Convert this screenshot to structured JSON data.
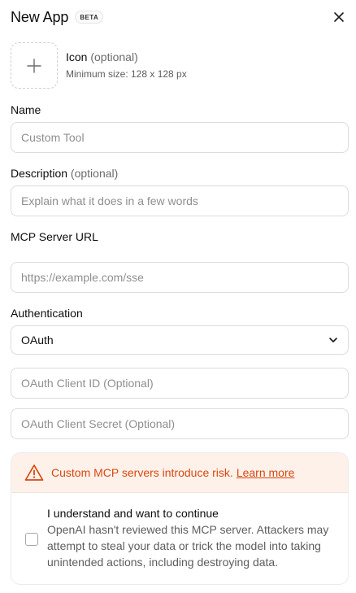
{
  "header": {
    "title": "New App",
    "badge": "BETA",
    "close_icon": "close-icon"
  },
  "icon_section": {
    "label": "Icon",
    "optional": "(optional)",
    "hint": "Minimum size: 128 x 128 px",
    "upload_icon": "plus-icon"
  },
  "name": {
    "label": "Name",
    "placeholder": "Custom Tool",
    "value": ""
  },
  "description": {
    "label": "Description",
    "optional": "(optional)",
    "placeholder": "Explain what it does in a few words",
    "value": ""
  },
  "mcp_url": {
    "label": "MCP Server URL",
    "placeholder": "https://example.com/sse",
    "value": ""
  },
  "authentication": {
    "label": "Authentication",
    "selected": "OAuth",
    "chevron_icon": "chevron-down-icon"
  },
  "oauth_client_id": {
    "placeholder": "OAuth Client ID (Optional)",
    "value": ""
  },
  "oauth_client_secret": {
    "placeholder": "OAuth Client Secret (Optional)",
    "value": ""
  },
  "warning": {
    "icon": "warning-icon",
    "text": "Custom MCP servers introduce risk.",
    "link": "Learn more",
    "color": "#d9480f",
    "background": "#fdf1ea"
  },
  "consent": {
    "checked": false,
    "title": "I understand and want to continue",
    "body": "OpenAI hasn't reviewed this MCP server. Attackers may attempt to steal your data or trick the model into taking unintended actions, including destroying data."
  }
}
